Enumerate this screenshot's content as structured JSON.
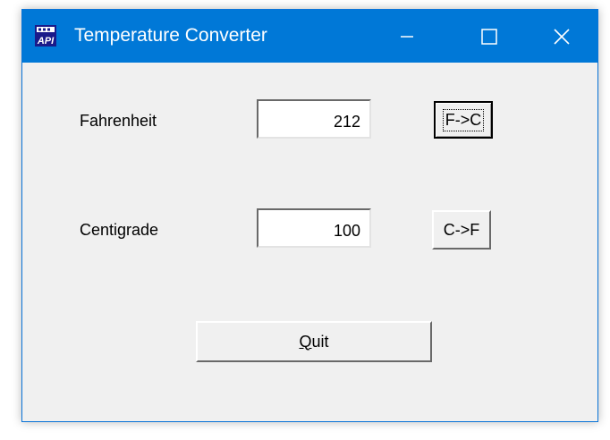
{
  "window": {
    "title": "Temperature Converter",
    "icon": "api-app-icon",
    "controls": {
      "minimize": "minimize-icon",
      "maximize": "maximize-icon",
      "close": "close-icon"
    }
  },
  "form": {
    "fahrenheit_label": "Fahrenheit",
    "fahrenheit_value": "212",
    "f_to_c_button": "F->C",
    "centigrade_label": "Centigrade",
    "centigrade_value": "100",
    "c_to_f_button": "C->F",
    "quit_button": {
      "mnemonic": "Q",
      "rest": "uit"
    }
  },
  "colors": {
    "titlebar": "#0078d7",
    "window_bg": "#f0f0f0"
  }
}
